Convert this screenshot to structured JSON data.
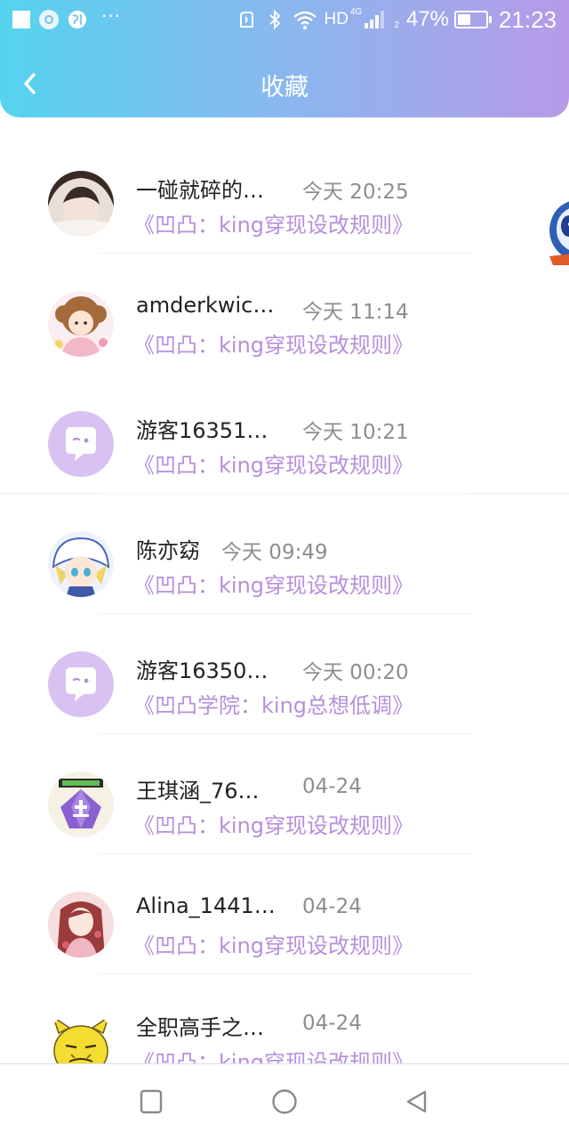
{
  "status_bar": {
    "more_dots": "···",
    "network_label": "HD",
    "network_sub": "4G",
    "signal_sub": "2",
    "battery_percent": "47%",
    "battery_level": 0.47,
    "time": "21:23",
    "icons": [
      "square-icon",
      "app-notification-icon",
      "globe-icon",
      "nfc-icon",
      "bluetooth-icon",
      "wifi-icon",
      "signal-icon",
      "battery-icon"
    ]
  },
  "header": {
    "title": "收藏",
    "back_icon": "chevron-left-icon",
    "gradient_colors": [
      "#55d3ef",
      "#8ab7ee",
      "#b79ae7"
    ]
  },
  "items": [
    {
      "name": "一碰就碎的…",
      "time": "今天 20:25",
      "subtitle": "《凹凸：king穿现设改规则》",
      "avatar": "photo-girl"
    },
    {
      "name": "amderkwic…",
      "time": "今天 11:14",
      "subtitle": "《凹凸：king穿现设改规则》",
      "avatar": "anime-brown-hair"
    },
    {
      "name": "游客16351…",
      "time": "今天 10:21",
      "subtitle": "《凹凸：king穿现设改规则》",
      "avatar": "default-chat"
    },
    {
      "name": "陈亦窈",
      "time": "今天 09:49",
      "subtitle": "《凹凸：king穿现设改规则》",
      "avatar": "anime-blonde-cap"
    },
    {
      "name": "游客16350…",
      "time": "今天 00:20",
      "subtitle": "《凹凸学院：king总想低调》",
      "avatar": "default-chat"
    },
    {
      "name": "王琪涵_76…",
      "time": "04-24",
      "subtitle": "《凹凸：king穿现设改规则》",
      "avatar": "purple-gem"
    },
    {
      "name": "Alina_1441…",
      "time": "04-24",
      "subtitle": "《凹凸：king穿现设改规则》",
      "avatar": "anime-red-hair"
    },
    {
      "name": "全职高手之…",
      "time": "04-24",
      "subtitle": "《凹凸：king穿现设改规则》",
      "avatar": "yellow-meme-face"
    }
  ],
  "colors": {
    "subtitle": "#b68fdb",
    "name": "#222222",
    "time": "#8e8e8e",
    "default_avatar_bg": "#d9c2f2"
  },
  "bottom_nav": {
    "buttons": [
      "recents-square-icon",
      "home-circle-icon",
      "back-triangle-icon"
    ]
  }
}
